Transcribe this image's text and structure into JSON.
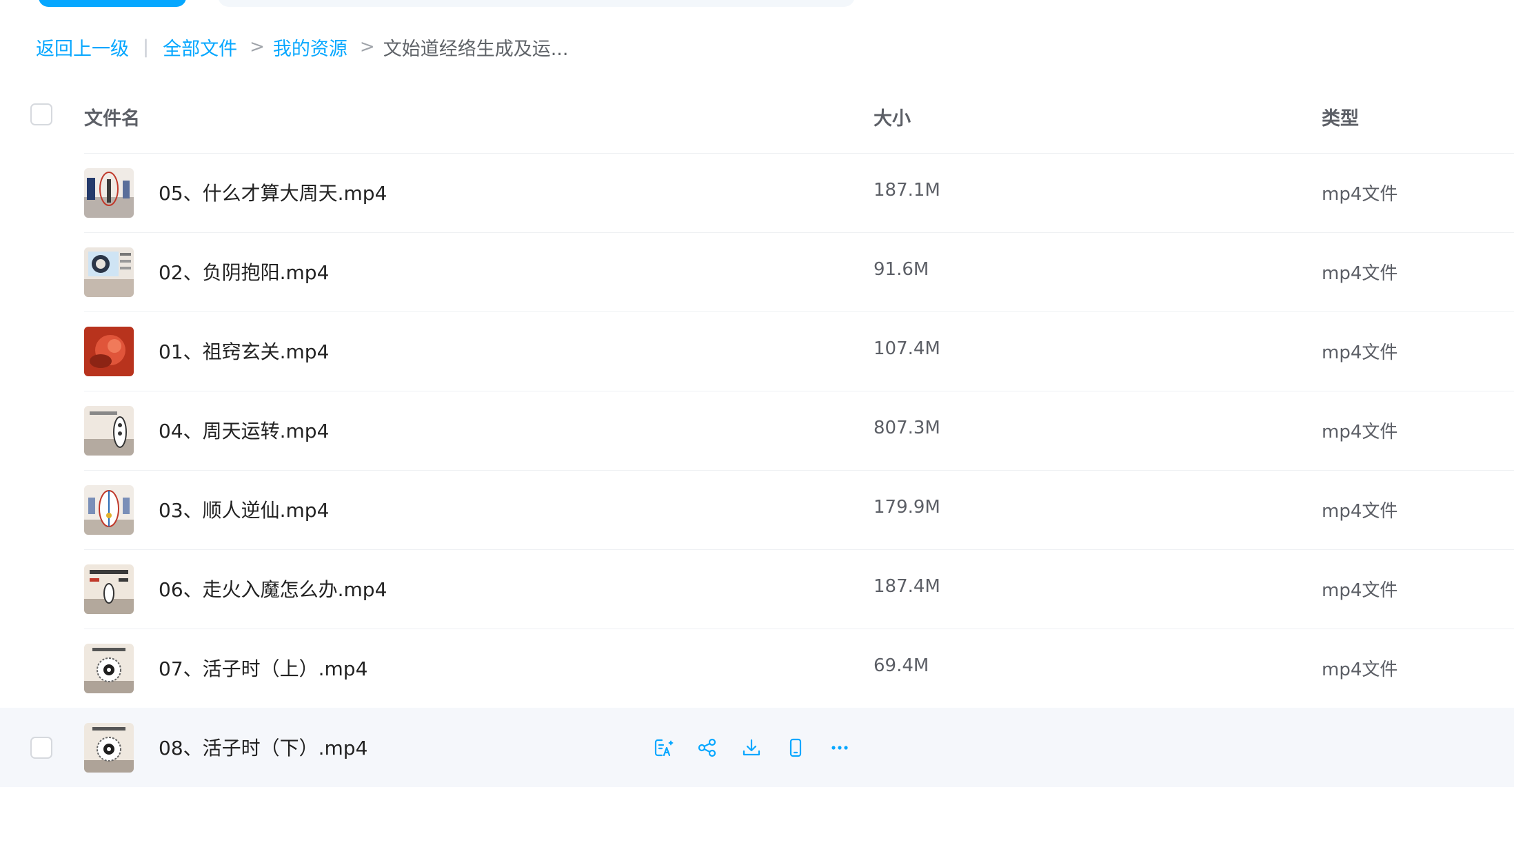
{
  "breadcrumb": {
    "back": "返回上一级",
    "separator": "|",
    "items": [
      "全部文件",
      "我的资源"
    ],
    "arrow": ">",
    "current": "文始道经络生成及运..."
  },
  "table": {
    "headers": {
      "name": "文件名",
      "size": "大小",
      "type": "类型"
    },
    "rows": [
      {
        "name": "05、什么才算大周天.mp4",
        "size": "187.1M",
        "type": "mp4文件"
      },
      {
        "name": "02、负阴抱阳.mp4",
        "size": "91.6M",
        "type": "mp4文件"
      },
      {
        "name": "01、祖窍玄关.mp4",
        "size": "107.4M",
        "type": "mp4文件"
      },
      {
        "name": "04、周天运转.mp4",
        "size": "807.3M",
        "type": "mp4文件"
      },
      {
        "name": "03、顺人逆仙.mp4",
        "size": "179.9M",
        "type": "mp4文件"
      },
      {
        "name": "06、走火入魔怎么办.mp4",
        "size": "187.4M",
        "type": "mp4文件"
      },
      {
        "name": "07、活子时（上）.mp4",
        "size": "69.4M",
        "type": "mp4文件"
      },
      {
        "name": "08、活子时（下）.mp4",
        "size": "",
        "type": ""
      }
    ]
  },
  "hover_actions": [
    "ai-summary-icon",
    "share-icon",
    "download-icon",
    "phone-icon",
    "more-icon"
  ],
  "colors": {
    "accent": "#06a7ff",
    "hover_row": "#f5f7fb"
  }
}
